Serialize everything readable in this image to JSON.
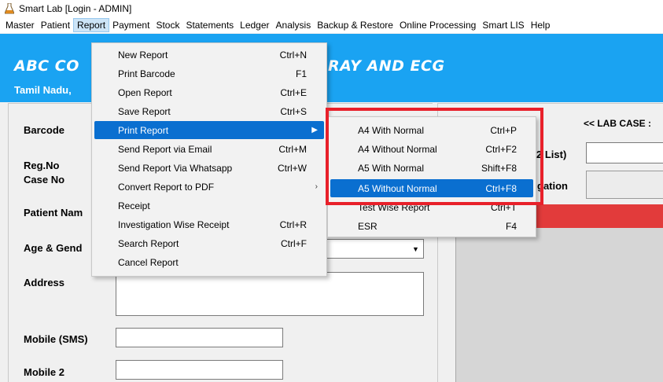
{
  "window": {
    "title": "Smart Lab [Login -  ADMIN]"
  },
  "menubar": {
    "items": [
      "Master",
      "Patient",
      "Report",
      "Payment",
      "Stock",
      "Statements",
      "Ledger",
      "Analysis",
      "Backup & Restore",
      "Online Processing",
      "Smart LIS",
      "Help"
    ],
    "active": "Report"
  },
  "banner": {
    "title_left": "ABC CO",
    "title_right": "RAY AND ECG",
    "subtitle": "Tamil Nadu,"
  },
  "form": {
    "barcode_label": "Barcode",
    "regno_label": "Reg.No",
    "caseno_label": "Case No",
    "patient_name_label": "Patient Nam",
    "age_gender_label": "Age & Gend",
    "address_label": "Address",
    "mobile_sms_label": "Mobile (SMS)",
    "mobile2_label": "Mobile 2"
  },
  "right_panel": {
    "lab_case": "<< LAB CASE :",
    "list_label": "2 List)",
    "gation_label": "gation"
  },
  "report_menu": {
    "items": [
      {
        "label": "New Report",
        "shortcut": "Ctrl+N"
      },
      {
        "label": "Print Barcode",
        "shortcut": "F1"
      },
      {
        "label": "Open Report",
        "shortcut": "Ctrl+E"
      },
      {
        "label": "Save Report",
        "shortcut": "Ctrl+S"
      },
      {
        "label": "Print Report",
        "shortcut": ""
      },
      {
        "label": "Send Report via Email",
        "shortcut": "Ctrl+M"
      },
      {
        "label": "Send Report Via Whatsapp",
        "shortcut": "Ctrl+W"
      },
      {
        "label": "Convert Report to PDF",
        "shortcut": ""
      },
      {
        "label": "Receipt",
        "shortcut": ""
      },
      {
        "label": "Investigation Wise Receipt",
        "shortcut": "Ctrl+R"
      },
      {
        "label": "Search Report",
        "shortcut": "Ctrl+F"
      },
      {
        "label": "Cancel Report",
        "shortcut": ""
      }
    ],
    "highlighted": "Print Report"
  },
  "print_submenu": {
    "items": [
      {
        "label": "A4 With Normal",
        "shortcut": "Ctrl+P"
      },
      {
        "label": "A4 Without Normal",
        "shortcut": "Ctrl+F2"
      },
      {
        "label": "A5 With Normal",
        "shortcut": "Shift+F8"
      },
      {
        "label": "A5 Without Normal",
        "shortcut": "Ctrl+F8"
      },
      {
        "label": "Test Wise Report",
        "shortcut": "Ctrl+T"
      },
      {
        "label": "ESR",
        "shortcut": "F4"
      }
    ],
    "highlighted": "A5 Without Normal"
  },
  "colors": {
    "banner": "#1aa3f2",
    "menu_highlight": "#0a6fd0",
    "annotation_box": "#e8202a",
    "status_bar": "#e23b3b"
  },
  "icons": {
    "app": "flask-icon",
    "submenu": "chevron-right-icon",
    "combo": "dropdown-arrow-icon"
  }
}
